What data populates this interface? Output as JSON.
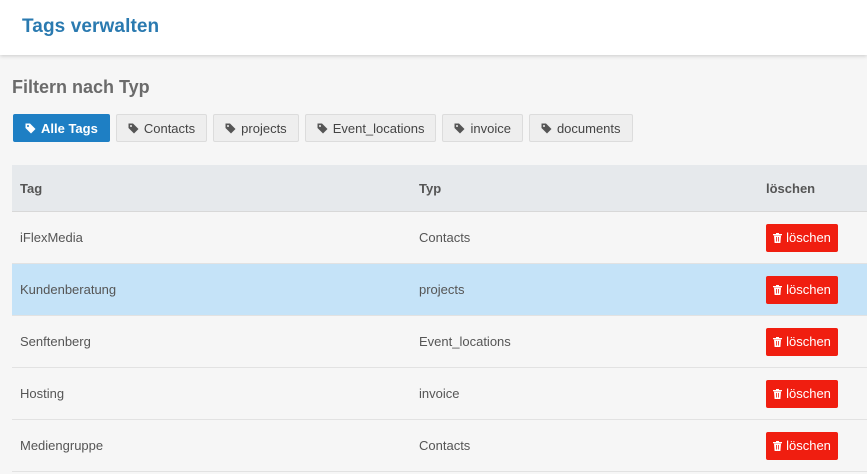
{
  "header": {
    "title": "Tags verwalten"
  },
  "filter": {
    "title": "Filtern nach Typ",
    "buttons": [
      {
        "label": "Alle Tags",
        "active": true
      },
      {
        "label": "Contacts",
        "active": false
      },
      {
        "label": "projects",
        "active": false
      },
      {
        "label": "Event_locations",
        "active": false
      },
      {
        "label": "invoice",
        "active": false
      },
      {
        "label": "documents",
        "active": false
      }
    ]
  },
  "table": {
    "headers": {
      "tag": "Tag",
      "typ": "Typ",
      "delete": "löschen"
    },
    "rows": [
      {
        "tag": "iFlexMedia",
        "typ": "Contacts",
        "delete": "löschen",
        "highlighted": false
      },
      {
        "tag": "Kundenberatung",
        "typ": "projects",
        "delete": "löschen",
        "highlighted": true
      },
      {
        "tag": "Senftenberg",
        "typ": "Event_locations",
        "delete": "löschen",
        "highlighted": false
      },
      {
        "tag": "Hosting",
        "typ": "invoice",
        "delete": "löschen",
        "highlighted": false
      },
      {
        "tag": "Mediengruppe",
        "typ": "Contacts",
        "delete": "löschen",
        "highlighted": false
      }
    ]
  },
  "colors": {
    "title": "#2a7ab0",
    "active_filter": "#1e7fc4",
    "delete_button": "#f01e10",
    "row_highlight": "#c5e3f8"
  },
  "icons": {
    "filter": "tag-icon",
    "delete": "trash-icon"
  }
}
